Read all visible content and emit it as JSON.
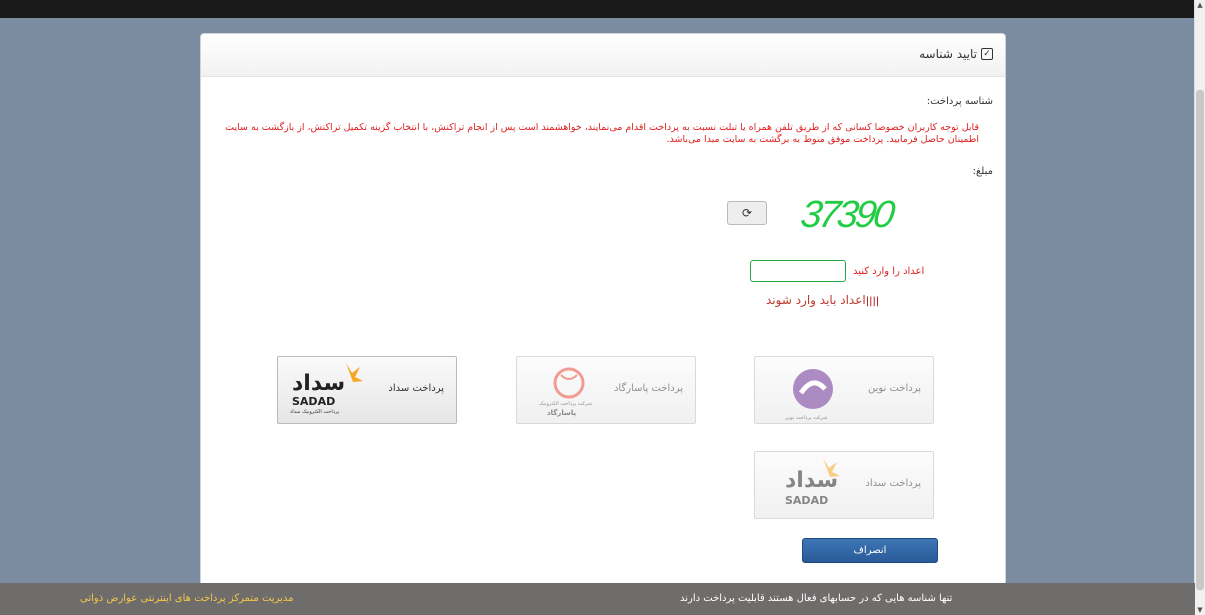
{
  "panel": {
    "title": "تایید شناسه",
    "payment_id_label": "شناسه پرداخت:",
    "notice": "قابل توجه کاربران خصوصا کسانی که از طریق تلفن همراه یا تبلت نسبت به پرداخت اقدام می‌نمایند، خواهشمند است پس از انجام تراکنش، با انتخاب گزینه تکمیل تراکنش، از بازگشت به سایت اطمینان حاصل فرمایید. پرداخت موفق منوط به برگشت به سایت مبدا می‌باشد.",
    "amount_label": "مبلغ:"
  },
  "captcha": {
    "image_text": "37390",
    "input_label": "اعداد را وارد کنید",
    "input_value": "",
    "error": "اعداد باید وارد شوند",
    "refresh_icon": "refresh-icon"
  },
  "gateways": [
    {
      "label": "پرداخت سداد",
      "logo_text": "سداد",
      "logo_latin": "SADAD",
      "logo_caption": "پرداخت الکترونیک سداد",
      "state": "enabled"
    },
    {
      "label": "پرداخت پاسارگاد",
      "logo_text": "پاسارگاد",
      "logo_caption": "شرکت پرداخت الکترونیک",
      "state": "disabled"
    },
    {
      "label": "پرداخت نوین",
      "logo_caption": "شرکت پرداخت نوین",
      "state": "disabled"
    },
    {
      "label": "پرداخت سداد",
      "logo_text": "سداد",
      "logo_latin": "SADAD",
      "state": "disabled"
    }
  ],
  "actions": {
    "cancel_label": "انصراف"
  },
  "footer": {
    "left": "مدیریت متمرکز پرداخت های اینترنتی عوارض ذواتی",
    "right": "تنها شناسه هایی که در حسابهای فعال هستند قابلیت پرداخت دارند"
  },
  "colors": {
    "accent": "#2a5a98",
    "error": "#e02020",
    "captcha": "#22cc44",
    "footer_text": "#f5c84b"
  }
}
